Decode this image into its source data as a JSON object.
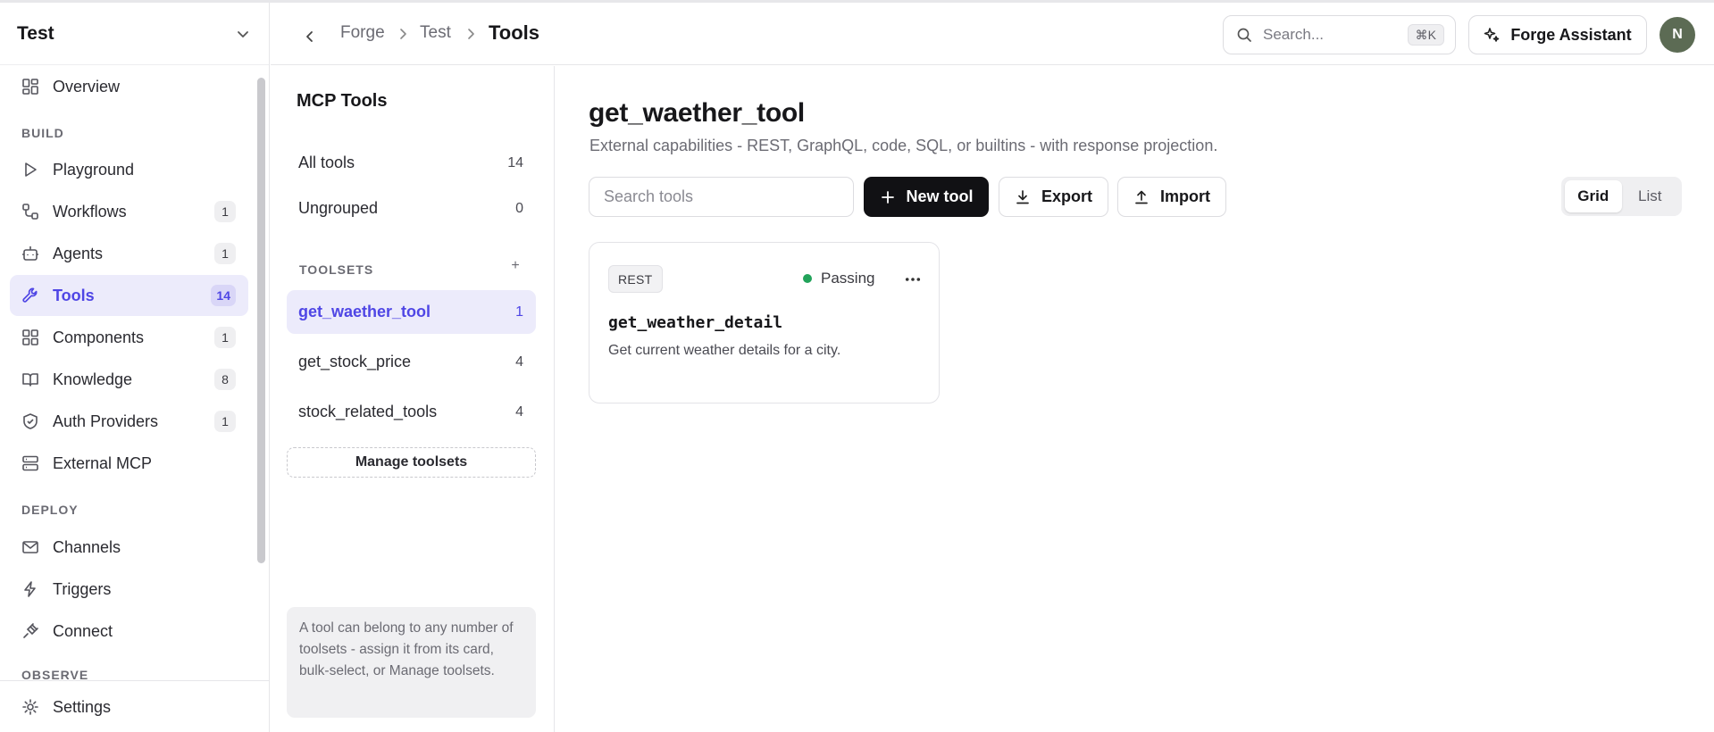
{
  "workspace": {
    "name": "Test"
  },
  "sidebar": {
    "sections": {
      "build": "BUILD",
      "deploy": "DEPLOY",
      "observe": "OBSERVE"
    },
    "items": [
      {
        "label": "Overview",
        "icon": "grid-icon"
      },
      {
        "label": "Playground",
        "icon": "play-icon"
      },
      {
        "label": "Workflows",
        "icon": "workflow-icon",
        "badge": "1"
      },
      {
        "label": "Agents",
        "icon": "bot-icon",
        "badge": "1"
      },
      {
        "label": "Tools",
        "icon": "wrench-icon",
        "badge": "14",
        "active": true
      },
      {
        "label": "Components",
        "icon": "components-icon",
        "badge": "1"
      },
      {
        "label": "Knowledge",
        "icon": "book-icon",
        "badge": "8"
      },
      {
        "label": "Auth Providers",
        "icon": "shield-icon",
        "badge": "1"
      },
      {
        "label": "External MCP",
        "icon": "server-icon"
      },
      {
        "label": "Channels",
        "icon": "mail-icon"
      },
      {
        "label": "Triggers",
        "icon": "bolt-icon"
      },
      {
        "label": "Connect",
        "icon": "plug-icon"
      }
    ],
    "footer": {
      "label": "Settings",
      "icon": "gear-icon"
    }
  },
  "header": {
    "breadcrumb": [
      "Forge",
      "Test",
      "Tools"
    ],
    "search": {
      "placeholder": "Search...",
      "shortcut": "⌘K"
    },
    "assistant_label": "Forge Assistant",
    "avatar_initial": "N"
  },
  "toolsets_panel": {
    "title": "MCP Tools",
    "rows": [
      {
        "label": "All tools",
        "count": "14"
      },
      {
        "label": "Ungrouped",
        "count": "0"
      }
    ],
    "section_label": "TOOLSETS",
    "add_symbol": "+",
    "toolsets": [
      {
        "label": "get_waether_tool",
        "count": "1",
        "active": true
      },
      {
        "label": "get_stock_price",
        "count": "4"
      },
      {
        "label": "stock_related_tools",
        "count": "4"
      }
    ],
    "manage_label": "Manage toolsets",
    "note": "A tool can belong to any number of toolsets - assign it from its card, bulk-select, or Manage toolsets."
  },
  "main": {
    "title": "get_waether_tool",
    "subtitle": "External capabilities - REST, GraphQL, code, SQL, or builtins - with response projection.",
    "search_placeholder": "Search tools",
    "new_tool_label": "New tool",
    "export_label": "Export",
    "import_label": "Import",
    "view_options": [
      "Grid",
      "List"
    ],
    "selected_view": "Grid",
    "cards": [
      {
        "type": "REST",
        "status": "Passing",
        "status_color": "#22a35a",
        "name": "get_weather_detail",
        "description": "Get current weather details for a city."
      }
    ]
  },
  "colors": {
    "accent": "#4f46e5",
    "accent_bg": "#ecebfb",
    "primary_button": "#111114"
  }
}
